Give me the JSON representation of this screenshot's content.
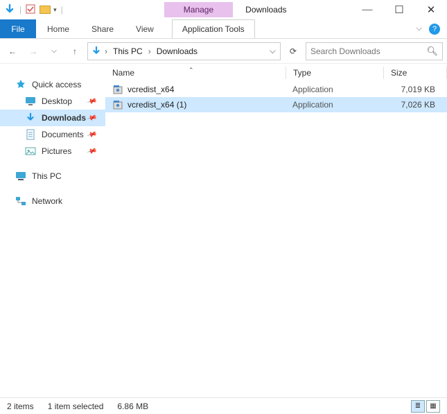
{
  "window": {
    "context_tab": "Manage",
    "title": "Downloads"
  },
  "ribbon": {
    "file": "File",
    "tabs": [
      "Home",
      "Share",
      "View"
    ],
    "app_tools": "Application Tools"
  },
  "breadcrumb": {
    "root": "This PC",
    "current": "Downloads"
  },
  "search": {
    "placeholder": "Search Downloads"
  },
  "columns": {
    "name": "Name",
    "type": "Type",
    "size": "Size"
  },
  "files": [
    {
      "name": "vcredist_x64",
      "type": "Application",
      "size": "7,019 KB",
      "selected": false
    },
    {
      "name": "vcredist_x64 (1)",
      "type": "Application",
      "size": "7,026 KB",
      "selected": true
    }
  ],
  "sidebar": {
    "quick": "Quick access",
    "items": [
      {
        "label": "Desktop",
        "icon": "desktop",
        "pinned": true,
        "selected": false
      },
      {
        "label": "Downloads",
        "icon": "download",
        "pinned": true,
        "selected": true
      },
      {
        "label": "Documents",
        "icon": "document",
        "pinned": true,
        "selected": false
      },
      {
        "label": "Pictures",
        "icon": "pictures",
        "pinned": true,
        "selected": false
      }
    ],
    "thispc": "This PC",
    "network": "Network"
  },
  "status": {
    "count": "2 items",
    "selected": "1 item selected",
    "size": "6.86 MB"
  }
}
